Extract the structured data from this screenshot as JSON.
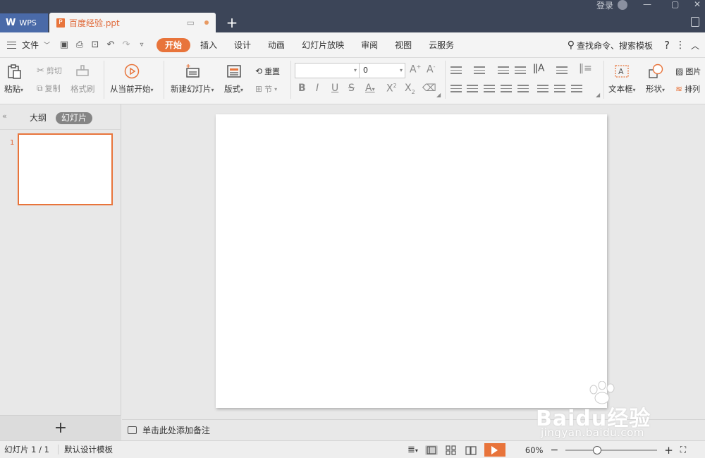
{
  "titlebar": {
    "wps_tab": "WPS",
    "doc_tab": "百度经验.ppt",
    "login": "登录"
  },
  "menubar": {
    "file": "文件",
    "tabs": [
      "开始",
      "插入",
      "设计",
      "动画",
      "幻灯片放映",
      "审阅",
      "视图",
      "云服务"
    ],
    "active_tab": "开始",
    "search": "查找命令、搜索模板",
    "help": "?"
  },
  "ribbon": {
    "paste": "粘贴",
    "cut": "剪切",
    "copy": "复制",
    "format_painter": "格式刷",
    "from_current": "从当前开始",
    "new_slide": "新建幻灯片",
    "layout": "版式",
    "reset": "重置",
    "section": "节",
    "font_name": "",
    "font_size": "0",
    "text_box": "文本框",
    "shape": "形状",
    "picture": "图片",
    "arrange": "排列"
  },
  "left_panel": {
    "tab_outline": "大纲",
    "tab_slides": "幻灯片",
    "active": "幻灯片",
    "slides": [
      {
        "num": "1"
      }
    ],
    "add": "+"
  },
  "notes": {
    "placeholder": "单击此处添加备注"
  },
  "statusbar": {
    "slide_count": "幻灯片 1 / 1",
    "template": "默认设计模板",
    "zoom": "60%",
    "zoom_level": 0.6
  },
  "watermark": {
    "logo": "Baidu经验",
    "url": "jingyan.baidu.com"
  },
  "colors": {
    "accent": "#e8743b",
    "titlebar": "#3c4558",
    "wps_tab": "#4a6aa8"
  }
}
